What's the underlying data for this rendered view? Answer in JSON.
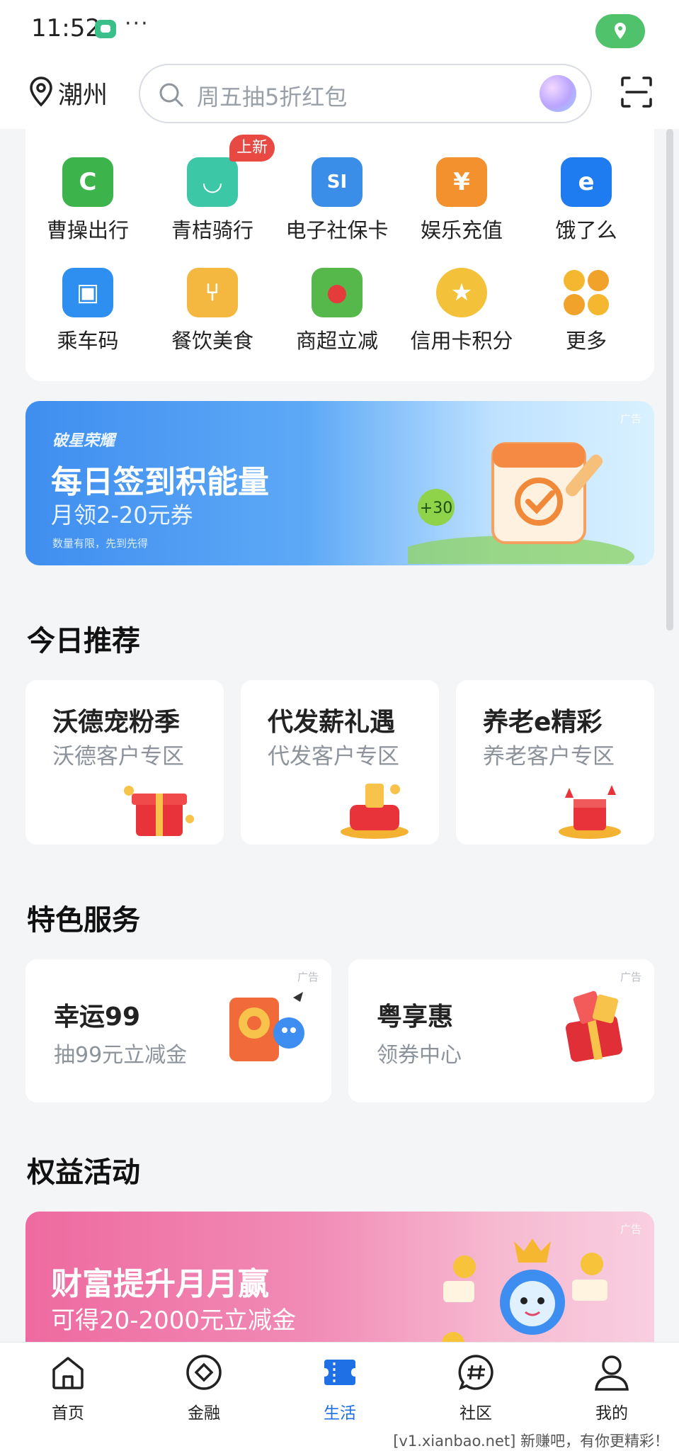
{
  "status_bar": {
    "time": "11:52",
    "dots": "···"
  },
  "header": {
    "city": "潮州",
    "search_placeholder": "周五抽5折红包"
  },
  "quick_services": [
    {
      "label": "曹操出行",
      "icon": "cao-cao-icon",
      "color": "#3cb44b",
      "glyph": "C"
    },
    {
      "label": "青桔骑行",
      "icon": "qingju-icon",
      "color": "#3cc7a6",
      "glyph": "◡",
      "badge": "上新"
    },
    {
      "label": "电子社保卡",
      "icon": "social-security-icon",
      "color": "#3b8ee8",
      "glyph": "SI"
    },
    {
      "label": "娱乐充值",
      "icon": "entertainment-icon",
      "color": "#f2912d",
      "glyph": "¥"
    },
    {
      "label": "饿了么",
      "icon": "eleme-icon",
      "color": "#1f7bf0",
      "glyph": "e"
    },
    {
      "label": "乘车码",
      "icon": "bus-code-icon",
      "color": "#2e8ff0",
      "glyph": "▣"
    },
    {
      "label": "餐饮美食",
      "icon": "food-icon",
      "color": "#f4b840",
      "glyph": "⑂"
    },
    {
      "label": "商超立减",
      "icon": "supermarket-icon",
      "color": "#56b84a",
      "glyph": "●"
    },
    {
      "label": "信用卡积分",
      "icon": "credit-points-icon",
      "color": "#f3c23a",
      "glyph": "★"
    },
    {
      "label": "更多",
      "icon": "more-icon",
      "color": "#f3a62c",
      "glyph": ""
    }
  ],
  "banner_signin": {
    "brand": "破星荣耀",
    "title": "每日签到积能量",
    "subtitle": "月领2-20元券",
    "note": "数量有限，先到先得",
    "ad": "广告",
    "points": "+30"
  },
  "today_recommend": {
    "title": "今日推荐",
    "cards": [
      {
        "title": "沃德宠粉季",
        "subtitle": "沃德客户专区"
      },
      {
        "title": "代发薪礼遇",
        "subtitle": "代发客户专区"
      },
      {
        "title": "养老e精彩",
        "subtitle": "养老客户专区"
      }
    ]
  },
  "featured_services": {
    "title": "特色服务",
    "cards": [
      {
        "title": "幸运99",
        "subtitle": "抽99元立减金",
        "ad": "广告"
      },
      {
        "title": "粤享惠",
        "subtitle": "领券中心",
        "ad": "广告"
      }
    ]
  },
  "rights_activities": {
    "title": "权益活动",
    "banner": {
      "title": "财富提升月月赢",
      "subtitle": "可得20-2000元立减金",
      "ad": "广告"
    }
  },
  "bottom_nav": [
    {
      "label": "首页",
      "icon": "home-icon"
    },
    {
      "label": "金融",
      "icon": "finance-icon"
    },
    {
      "label": "生活",
      "icon": "life-icon",
      "active": true
    },
    {
      "label": "社区",
      "icon": "community-icon"
    },
    {
      "label": "我的",
      "icon": "profile-icon"
    }
  ],
  "watermark": "[v1.xianbao.net] 新赚吧，有你更精彩！",
  "colors": {
    "accent": "#1f6fe5",
    "status_green": "#4fc26b",
    "badge_red": "#e84a43"
  }
}
